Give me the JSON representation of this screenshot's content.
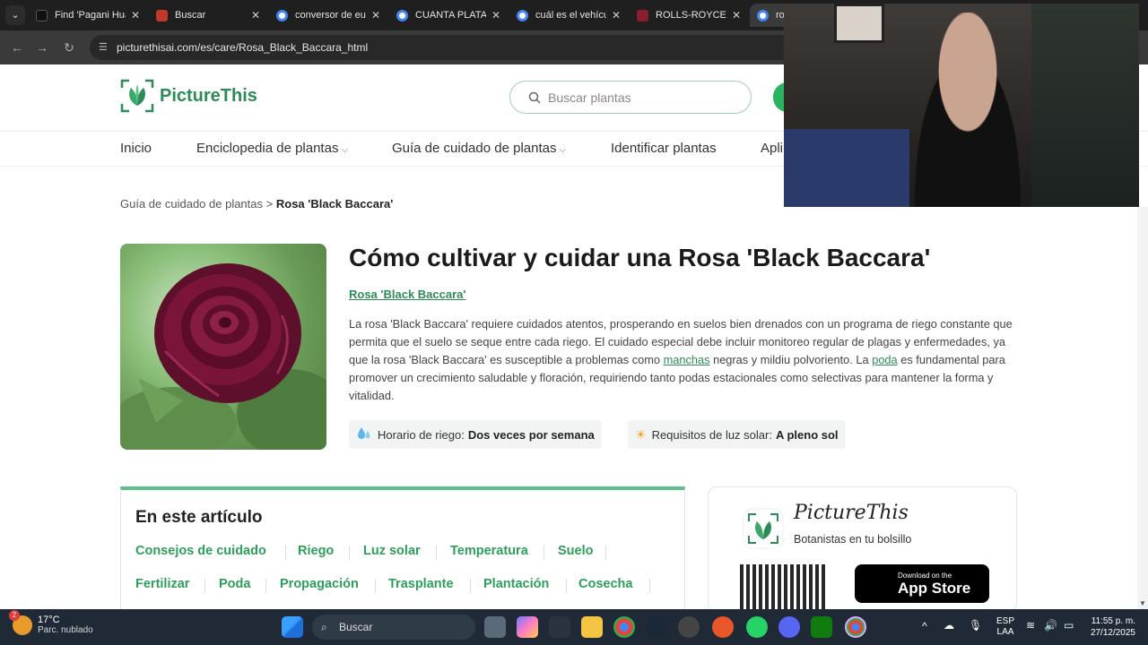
{
  "browser": {
    "tabs": [
      {
        "title": "Find 'Pagani Hua",
        "color": "#111111",
        "active": false
      },
      {
        "title": "Buscar",
        "color": "#c0392b",
        "active": false
      },
      {
        "title": "conversor de eu",
        "color": "#4285f4",
        "active": false
      },
      {
        "title": "CUANTA PLATA",
        "color": "#4285f4",
        "active": false
      },
      {
        "title": "cuál es el vehícul",
        "color": "#4285f4",
        "active": false
      },
      {
        "title": "ROLLS-ROYCE L",
        "color": "#8b1e2d",
        "active": false
      },
      {
        "title": "ros",
        "color": "#4285f4",
        "active": true
      }
    ],
    "url": "picturethisai.com/es/care/Rosa_Black_Baccara_html"
  },
  "site": {
    "logo": "PictureThis",
    "search_placeholder": "Buscar plantas",
    "nav": [
      "Inicio",
      "Enciclopedia de plantas",
      "Guía de cuidado de plantas",
      "Identificar plantas",
      "Apli"
    ]
  },
  "breadcrumb": {
    "parent": "Guía de cuidado de plantas",
    "separator": ">",
    "current": "Rosa 'Black Baccara'"
  },
  "article": {
    "title": "Cómo cultivar y cuidar una Rosa 'Black Baccara'",
    "plant_link": "Rosa 'Black Baccara'",
    "desc_1": "La rosa 'Black Baccara' requiere cuidados atentos, prosperando en suelos bien drenados con un programa de riego constante que permita que el suelo se seque entre cada riego. El cuidado especial debe incluir monitoreo regular de plagas y enfermedades, ya que la rosa 'Black Baccara' es susceptible a problemas como ",
    "link_manchas": "manchas",
    "desc_2": " negras y mildiu polvoriento. La ",
    "link_poda": "poda",
    "desc_3": " es fundamental para promover un crecimiento saludable y floración, requiriendo tanto podas estacionales como selectivas para mantener la forma y vitalidad.",
    "water_label": "Horario de riego:",
    "water_value": "Dos veces por semana",
    "light_label": "Requisitos de luz solar:",
    "light_value": "A pleno sol"
  },
  "toc": {
    "title": "En este artículo",
    "row1": [
      "Consejos de cuidado",
      "Riego",
      "Luz solar",
      "Temperatura",
      "Suelo"
    ],
    "row2": [
      "Fertilizar",
      "Poda",
      "Propagación",
      "Trasplante",
      "Plantación",
      "Cosecha"
    ]
  },
  "promo": {
    "name": "PictureThis",
    "tagline": "Botanistas en tu bolsillo",
    "appstore_small": "Download on the",
    "appstore_large": "App Store"
  },
  "taskbar": {
    "temp": "17°C",
    "weather": "Parc. nublado",
    "weather_badge": "2",
    "search": "Buscar",
    "lang1": "ESP",
    "lang2": "LAA",
    "time": "11:55 p. m.",
    "date": "27/12/2025"
  },
  "colors": {
    "brand_green": "#2e8b57",
    "toc_accent": "#5cc08a",
    "taskbar": "#202a36"
  }
}
